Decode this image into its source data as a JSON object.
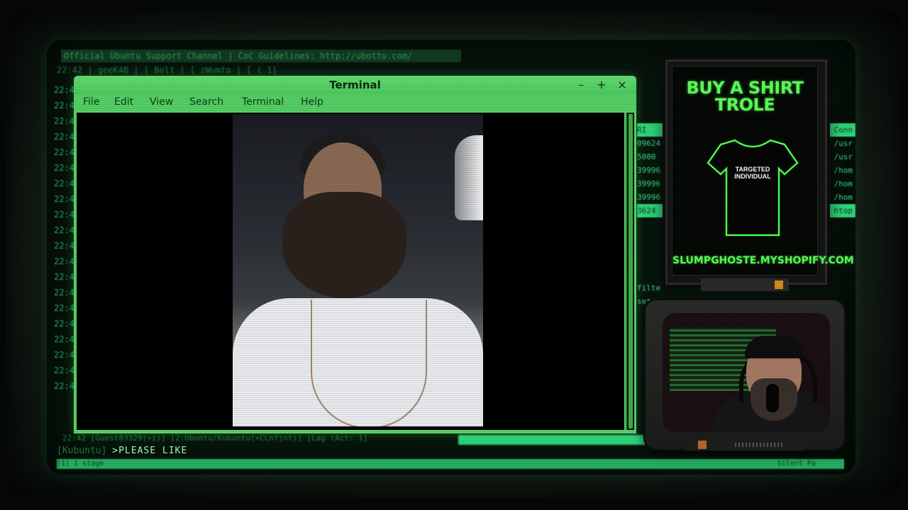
{
  "irc": {
    "topic": "Official Ubuntu Support Channel | CoC Guidelines: http://ubottu.com/",
    "nick_line": "22:42 | geeK4B        | [ Bolt         | [ zWumto            | [ (           1]",
    "timestamps": [
      "22:4",
      "22:4",
      "22:4",
      "22:4",
      "22:4",
      "22:4",
      "22:4",
      "22:4",
      "22:4",
      "22:4",
      "22:4",
      "22:4",
      "22:4",
      "22:4",
      "22:4",
      "22:4",
      "22:4",
      "22:4",
      "22:4",
      "22:4"
    ],
    "right_pane_rows": [
      {
        "left": "RI",
        "right": "Conn"
      },
      {
        "left": "09624",
        "right": "/usr"
      },
      {
        "left": "5000",
        "right": "/usr"
      },
      {
        "left": "39996",
        "right": "/hom"
      },
      {
        "left": "39996",
        "right": "/hom"
      },
      {
        "left": "39996",
        "right": "/hom"
      },
      {
        "left": "3624",
        "right": "htop"
      }
    ],
    "side_words": [
      "filte",
      "settings"
    ],
    "status_bar": "22:42 [Guest83329(+i)] [2:Ubuntu/Kubuntu(+CLnfjnt)] [Lag (Act: 1]",
    "prompt_box": "[Kubuntu]",
    "command_text": ">PLEASE LIKE",
    "bottom_left": "[1] 1 stage",
    "bottom_right": "Silent Pa"
  },
  "terminal": {
    "title": "Terminal",
    "minimize": "–",
    "maximize": "+",
    "close": "×",
    "menu": [
      "File",
      "Edit",
      "View",
      "Search",
      "Terminal",
      "Help"
    ]
  },
  "ad": {
    "title_line1": "BUY A SHIRT",
    "title_line2": "TROLE",
    "shirt_text_line1": "TARGETED",
    "shirt_text_line2": "INDIVIDUAL",
    "url": "SLUMPGHOSTE.MYSHOPIFY.COM"
  },
  "colors": {
    "terminal_chrome": "#58d468",
    "crt_green": "#33e88a",
    "ad_green": "#5bff59"
  }
}
